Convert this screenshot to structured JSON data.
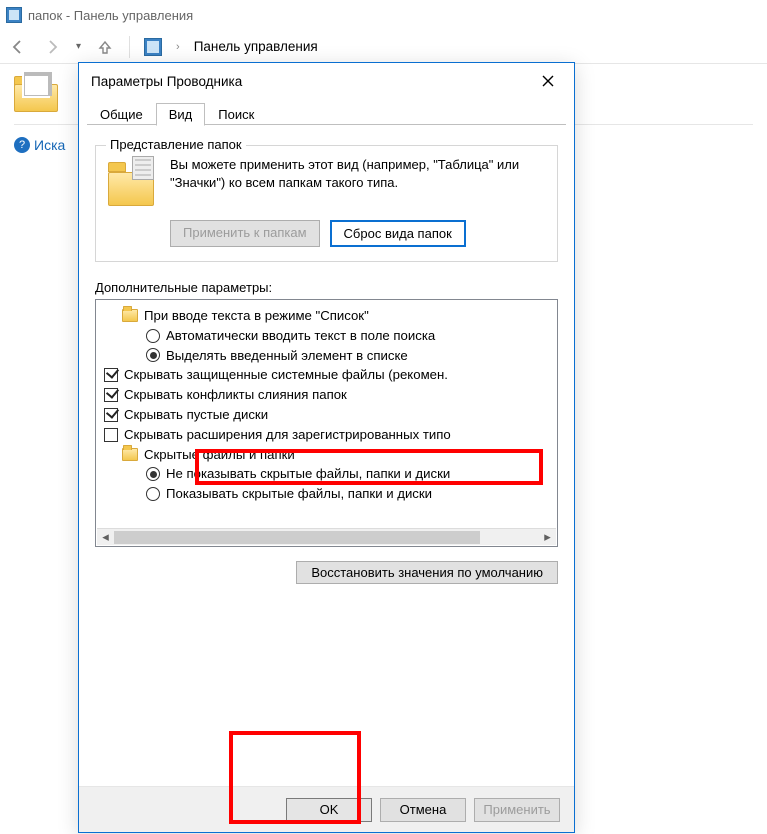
{
  "explorer": {
    "title_suffix": "папок - Панель управления",
    "breadcrumb": "Панель управления",
    "help_text": "Иска"
  },
  "dialog": {
    "title": "Параметры Проводника",
    "tabs": {
      "general": "Общие",
      "view": "Вид",
      "search": "Поиск"
    },
    "group": {
      "title": "Представление папок",
      "text": "Вы можете применить этот вид (например, \"Таблица\" или \"Значки\") ко всем папкам такого типа.",
      "apply_btn": "Применить к папкам",
      "reset_btn": "Сброс вида папок"
    },
    "adv_label": "Дополнительные параметры:",
    "tree": {
      "i0": "При вводе текста в режиме \"Список\"",
      "i1": "Автоматически вводить текст в поле поиска",
      "i2": "Выделять введенный элемент в списке",
      "i3": "Скрывать защищенные системные файлы (рекомен.",
      "i4": "Скрывать конфликты слияния папок",
      "i5": "Скрывать пустые диски",
      "i6": "Скрывать расширения для зарегистрированных типо",
      "i7": "Скрытые файлы и папки",
      "i8": "Не показывать скрытые файлы, папки и диски",
      "i9": "Показывать скрытые файлы, папки и диски"
    },
    "restore": "Восстановить значения по умолчанию",
    "footer": {
      "ok": "OK",
      "cancel": "Отмена",
      "apply": "Применить"
    }
  }
}
